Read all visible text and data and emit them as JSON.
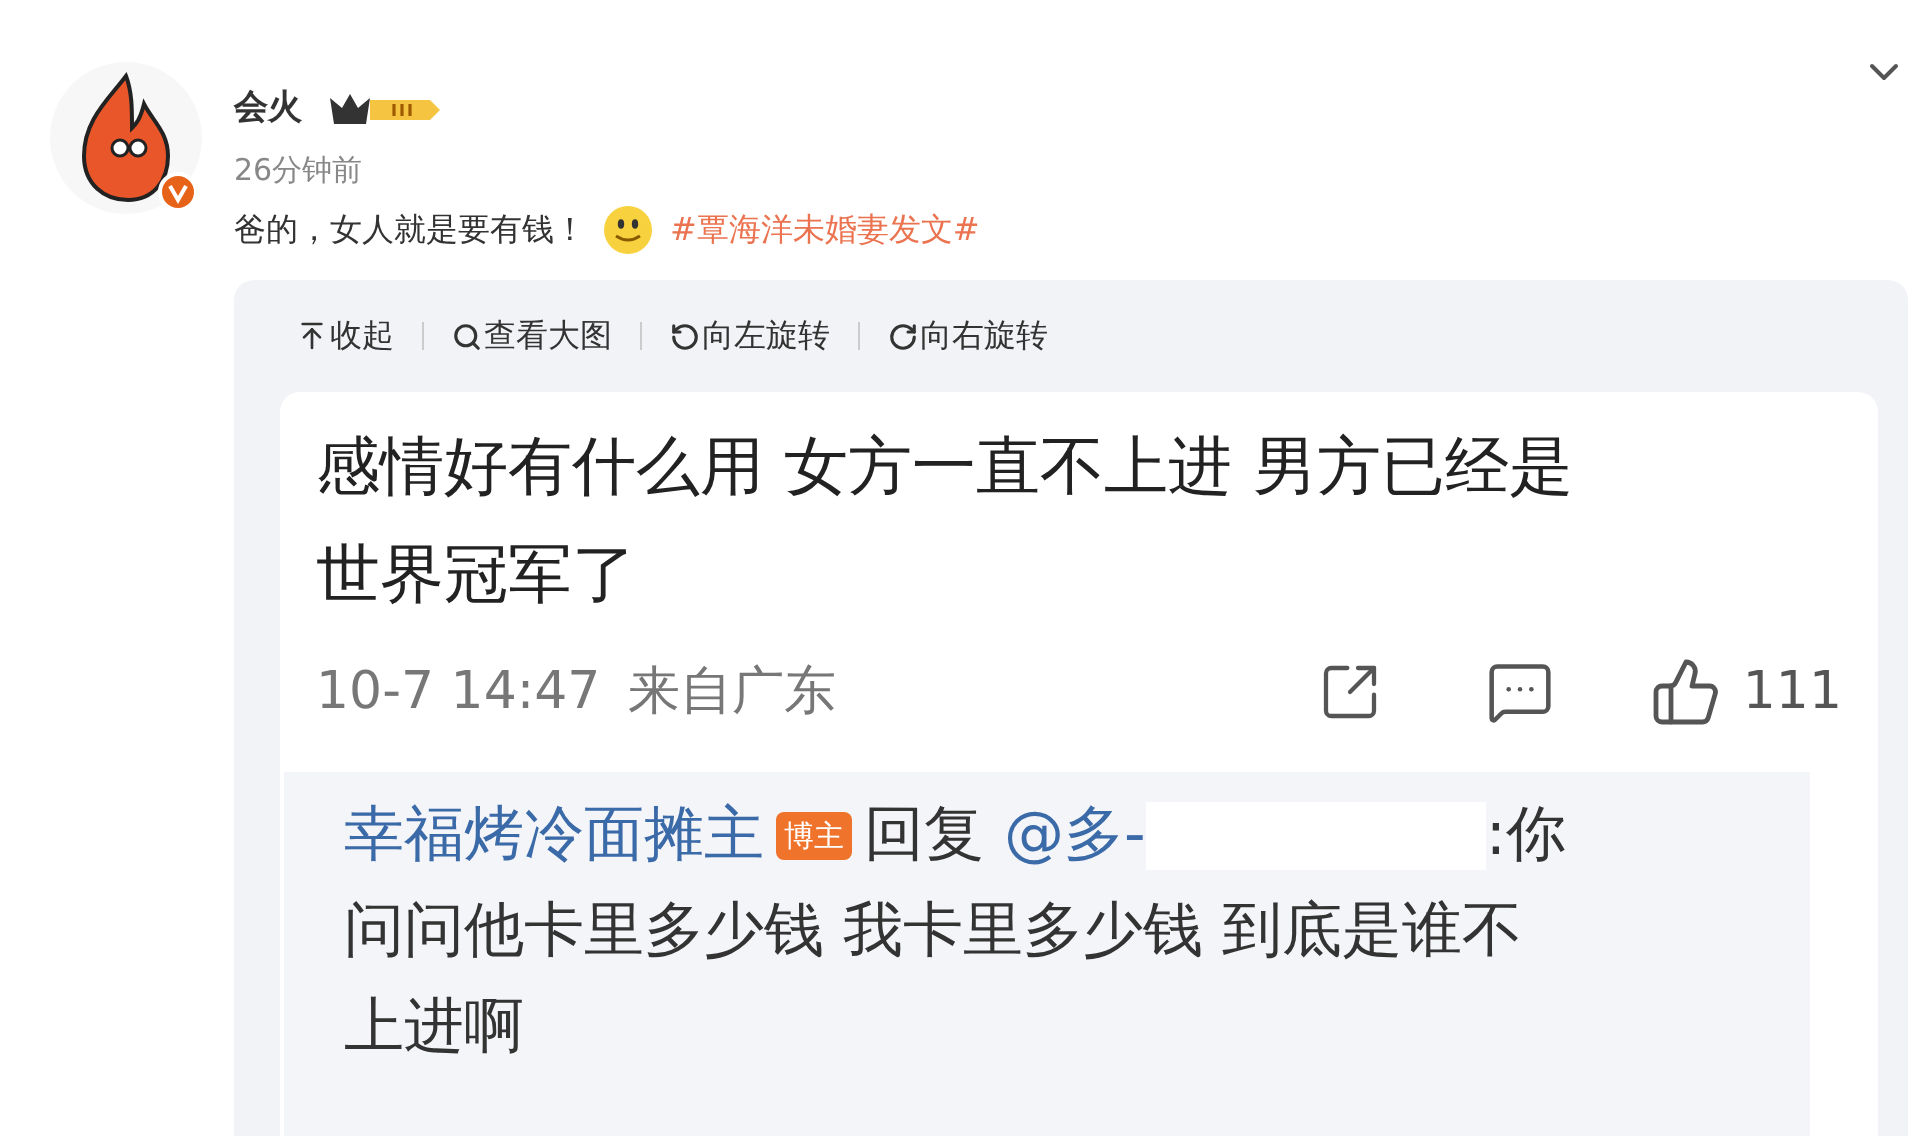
{
  "post": {
    "author": "会火",
    "time": "26分钟前",
    "text": "爸的，女人就是要有钱！",
    "hashtag": "#覃海洋未婚妻发文#"
  },
  "image_toolbar": [
    {
      "kind": "collapse",
      "label": "收起"
    },
    {
      "kind": "zoom",
      "label": "查看大图"
    },
    {
      "kind": "rotate-left",
      "label": "向左旋转"
    },
    {
      "kind": "rotate-right",
      "label": "向右旋转"
    }
  ],
  "comment": {
    "text_lines": [
      "感情好有什么用 女方一直不上进 男方已经是",
      "世界冠军了"
    ],
    "time": "10-7 14:47",
    "location": "来自广东",
    "likes": "111"
  },
  "reply": {
    "author": "幸福烤冷面摊主",
    "badge": "博主",
    "verb": "回复",
    "mention": "@多-",
    "text_lines": [
      ":你",
      "问问他卡里多少钱 我卡里多少钱 到底是谁不",
      "上进啊"
    ]
  }
}
